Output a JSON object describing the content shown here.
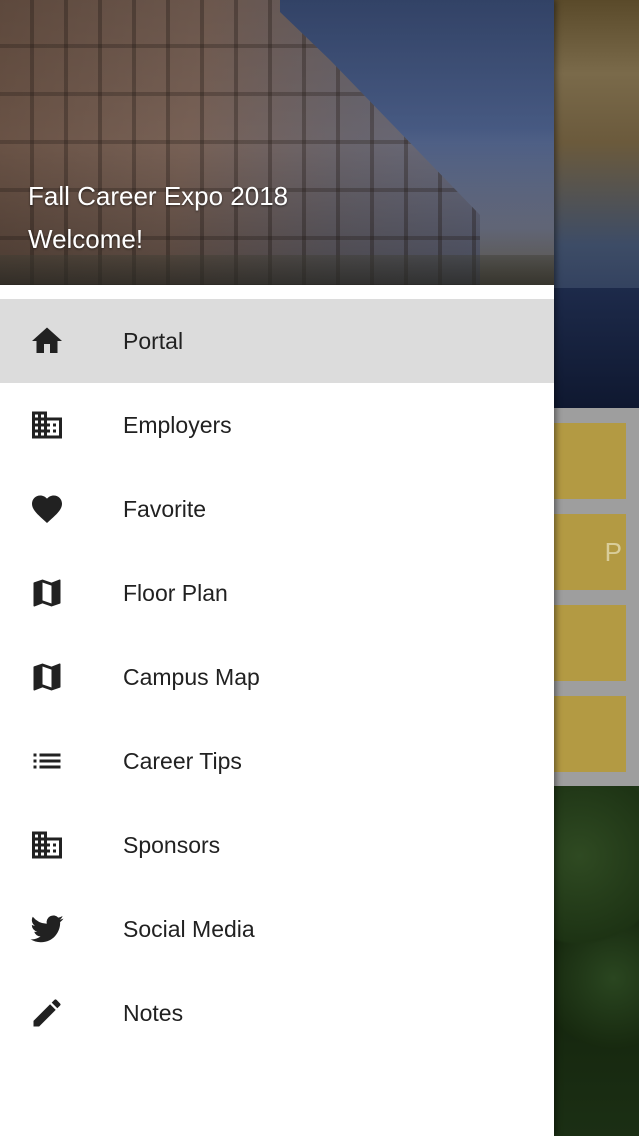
{
  "header": {
    "title": "Fall Career Expo 2018",
    "subtitle": "Welcome!"
  },
  "nav": {
    "items": [
      {
        "label": "Portal",
        "icon": "home-icon",
        "active": true
      },
      {
        "label": "Employers",
        "icon": "building-icon",
        "active": false
      },
      {
        "label": "Favorite",
        "icon": "heart-icon",
        "active": false
      },
      {
        "label": "Floor Plan",
        "icon": "map-icon",
        "active": false
      },
      {
        "label": "Campus Map",
        "icon": "map-icon",
        "active": false
      },
      {
        "label": "Career Tips",
        "icon": "list-icon",
        "active": false
      },
      {
        "label": "Sponsors",
        "icon": "building-icon",
        "active": false
      },
      {
        "label": "Social Media",
        "icon": "twitter-icon",
        "active": false
      },
      {
        "label": "Notes",
        "icon": "pencil-icon",
        "active": false
      }
    ]
  },
  "background_app": {
    "partial_tile_text": "P"
  },
  "colors": {
    "active_item_bg": "#dcdcdc",
    "text": "#212121",
    "tile_gold": "#b39a43"
  }
}
